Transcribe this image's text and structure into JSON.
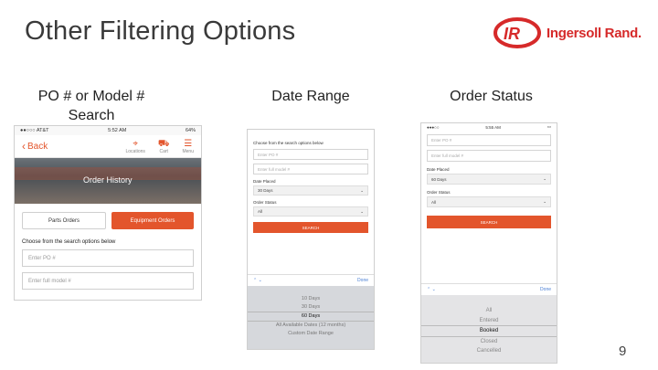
{
  "slide": {
    "title": "Other Filtering Options",
    "page_number": "9"
  },
  "logo": {
    "text": "Ingersoll Rand."
  },
  "headings": {
    "col1": "PO # or Model # Search",
    "col2": "Date Range",
    "col3": "Order Status"
  },
  "phone1": {
    "status_left": "●●○○○ AT&T",
    "status_time": "5:52 AM",
    "status_right": "64%",
    "back_label": "Back",
    "nav_icons": [
      {
        "icon": "location-pin-icon",
        "label": "Locations"
      },
      {
        "icon": "cart-icon",
        "label": "Cart"
      },
      {
        "icon": "menu-icon",
        "label": "Menu"
      }
    ],
    "hero_title": "Order History",
    "tabs": [
      "Parts Orders",
      "Equipment Orders"
    ],
    "choose_label": "Choose from the search options below",
    "po_placeholder": "Enter PO #",
    "model_placeholder": "Enter full model #"
  },
  "phone2": {
    "choose_label": "Choose from the search options below",
    "po_placeholder": "Enter PO #",
    "model_placeholder": "Enter full model #",
    "date_label": "Date Placed",
    "date_value": "30 Days",
    "status_label": "Order Status",
    "status_value": "All",
    "search_label": "SEARCH",
    "done_label": "Done",
    "picker_options": [
      "10 Days",
      "30 Days",
      "60 Days",
      "All Available Dates (12 months)",
      "Custom Date Range"
    ],
    "picker_selected_index": 2
  },
  "phone3": {
    "status_time": "5:55 AM",
    "po_placeholder": "Enter PO #",
    "model_placeholder": "Enter full model #",
    "date_label": "Date Placed",
    "date_value": "60 Days",
    "status_label": "Order Status",
    "status_value": "All",
    "search_label": "SEARCH",
    "done_label": "Done",
    "picker_options": [
      "All",
      "Entered",
      "Booked",
      "Closed",
      "Cancelled"
    ],
    "picker_selected_index": 2
  },
  "colors": {
    "accent": "#e3552c",
    "brand_red": "#d62a2a",
    "link_blue": "#4a7fd4"
  }
}
